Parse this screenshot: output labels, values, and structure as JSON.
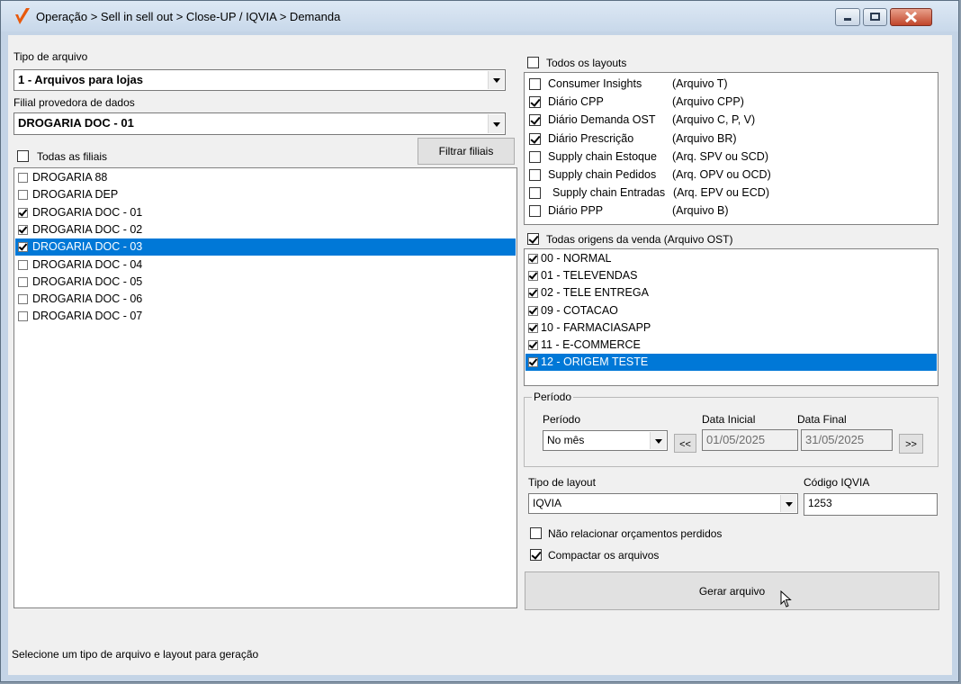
{
  "window": {
    "title": "Operação > Sell in sell out > Close-UP / IQVIA > Demanda",
    "icons": [
      "checkmark-logo-icon",
      "minimize-icon",
      "maximize-icon",
      "close-icon"
    ]
  },
  "left": {
    "tipo_label": "Tipo de arquivo",
    "tipo_value": "1 - Arquivos para lojas",
    "filial_label": "Filial provedora de dados",
    "filial_value": "DROGARIA DOC - 01",
    "todas_filiais_label": "Todas as filiais",
    "todas_filiais_checked": false,
    "filtrar_button": "Filtrar filiais",
    "filiais": [
      {
        "label": "DROGARIA 88",
        "checked": false,
        "selected": false
      },
      {
        "label": "DROGARIA DEP",
        "checked": false,
        "selected": false
      },
      {
        "label": "DROGARIA DOC - 01",
        "checked": true,
        "selected": false
      },
      {
        "label": "DROGARIA DOC - 02",
        "checked": true,
        "selected": false
      },
      {
        "label": "DROGARIA DOC - 03",
        "checked": true,
        "selected": true
      },
      {
        "label": "DROGARIA DOC - 04",
        "checked": false,
        "selected": false
      },
      {
        "label": "DROGARIA DOC - 05",
        "checked": false,
        "selected": false
      },
      {
        "label": "DROGARIA DOC - 06",
        "checked": false,
        "selected": false
      },
      {
        "label": "DROGARIA DOC - 07",
        "checked": false,
        "selected": false
      }
    ]
  },
  "right": {
    "todos_layouts_label": "Todos os layouts",
    "todos_layouts_checked": false,
    "layouts": [
      {
        "name": "Consumer Insights",
        "file": "(Arquivo T)",
        "checked": false
      },
      {
        "name": "Diário CPP",
        "file": "(Arquivo CPP)",
        "checked": true
      },
      {
        "name": "Diário Demanda OST",
        "file": "(Arquivo C, P, V)",
        "checked": true
      },
      {
        "name": "Diário Prescrição",
        "file": "(Arquivo BR)",
        "checked": true
      },
      {
        "name": "Supply chain Estoque",
        "file": "(Arq. SPV ou SCD)",
        "checked": false
      },
      {
        "name": "Supply chain Pedidos",
        "file": "(Arq. OPV ou OCD)",
        "checked": false
      },
      {
        "name": "Supply chain Entradas",
        "file": "(Arq. EPV ou ECD)",
        "checked": false
      },
      {
        "name": "Diário PPP",
        "file": "(Arquivo B)",
        "checked": false
      }
    ],
    "todas_origens_label": "Todas origens da venda (Arquivo OST)",
    "todas_origens_checked": true,
    "origens": [
      {
        "label": "00 - NORMAL",
        "checked": true,
        "selected": false
      },
      {
        "label": "01 - TELEVENDAS",
        "checked": true,
        "selected": false
      },
      {
        "label": "02 - TELE ENTREGA",
        "checked": true,
        "selected": false
      },
      {
        "label": "09 - COTACAO",
        "checked": true,
        "selected": false
      },
      {
        "label": "10 - FARMACIASAPP",
        "checked": true,
        "selected": false
      },
      {
        "label": "11 - E-COMMERCE",
        "checked": true,
        "selected": false
      },
      {
        "label": "12 - ORIGEM TESTE",
        "checked": true,
        "selected": true
      }
    ],
    "periodo": {
      "group_title": "Período",
      "periodo_label": "Período",
      "periodo_value": "No mês",
      "data_inicial_label": "Data Inicial",
      "data_inicial": "01/05/2025",
      "data_final_label": "Data Final",
      "data_final": "31/05/2025",
      "prev_button": "<<",
      "next_button": ">>"
    },
    "tipo_layout_label": "Tipo de layout",
    "tipo_layout_value": "IQVIA",
    "codigo_label": "Código IQVIA",
    "codigo_value": "1253",
    "nao_relacionar_label": "Não relacionar orçamentos perdidos",
    "nao_relacionar_checked": false,
    "compactar_label": "Compactar os arquivos",
    "compactar_checked": true,
    "gerar_button": "Gerar arquivo"
  },
  "status": "Selecione um tipo de arquivo e layout para geração",
  "colors": {
    "selection": "#0078d7",
    "titlebar": "#c8d8ea",
    "client": "#f0f0f0",
    "close": "#c0452a"
  }
}
